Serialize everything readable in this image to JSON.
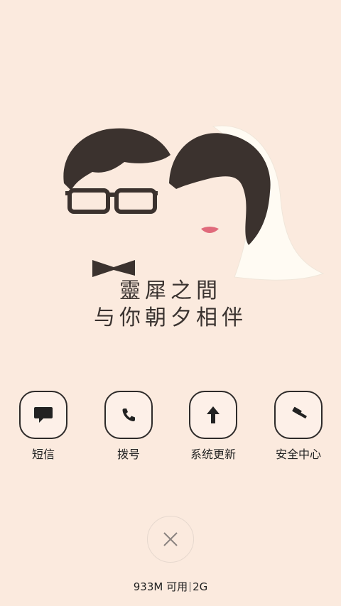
{
  "tagline": {
    "line1": "靈犀之間",
    "line2": "与你朝夕相伴"
  },
  "dock": [
    {
      "label": "短信",
      "icon": "chat-bubble-icon"
    },
    {
      "label": "拨号",
      "icon": "phone-icon"
    },
    {
      "label": "系统更新",
      "icon": "arrow-up-icon"
    },
    {
      "label": "安全中心",
      "icon": "gavel-icon"
    }
  ],
  "close": {
    "icon": "close-icon"
  },
  "status": {
    "memory": "933M 可用",
    "network": "2G"
  },
  "colors": {
    "background": "#fbeade",
    "ink": "#2e2b2a",
    "veil": "#fffbf3",
    "lip": "#e06a7b"
  }
}
